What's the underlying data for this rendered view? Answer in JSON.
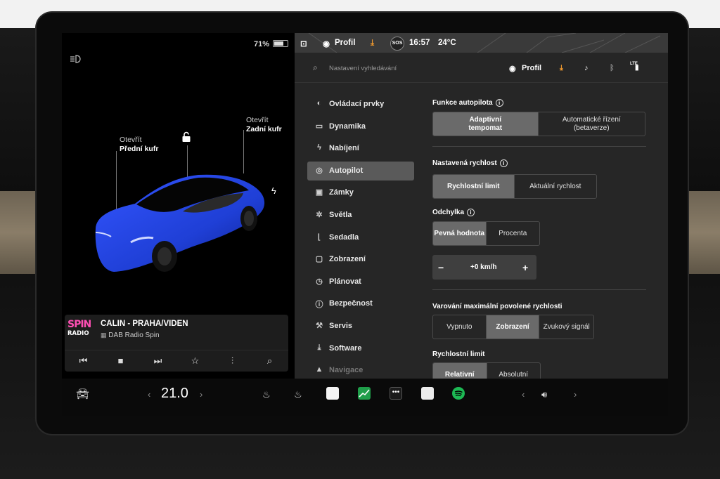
{
  "left": {
    "battery_pct": "71%",
    "battery_level": 0.71,
    "front_trunk": {
      "line1": "Otevřít",
      "line2": "Přední kufr"
    },
    "rear_trunk": {
      "line1": "Otevřít",
      "line2": "Zadní kufr"
    },
    "icons": {
      "headlight": "headlight-icon",
      "unlock": "unlock-icon",
      "charge": "bolt-icon"
    }
  },
  "media": {
    "logo_top": "SPIN",
    "logo_bottom": "RADIO",
    "title": "CALIN - PRAHA/VIDEN",
    "source": "DAB Radio Spin",
    "controls": [
      "previous-icon",
      "stop-icon",
      "next-icon",
      "star-icon",
      "equalizer-icon",
      "search-icon"
    ]
  },
  "status_bar": {
    "profile": "Profil",
    "sos": "SOS",
    "time": "16:57",
    "temp": "24°C"
  },
  "search": {
    "placeholder": "Nastavení vyhledávání",
    "profile": "Profil",
    "lte": "LTE"
  },
  "nav": [
    {
      "label": "Ovládací prvky",
      "icon": "toggle-icon",
      "glyph": "◐"
    },
    {
      "label": "Dynamika",
      "icon": "car-icon",
      "glyph": "▭"
    },
    {
      "label": "Nabíjení",
      "icon": "bolt-icon",
      "glyph": "ϟ"
    },
    {
      "label": "Autopilot",
      "icon": "steering-wheel-icon",
      "glyph": "◎",
      "active": true
    },
    {
      "label": "Zámky",
      "icon": "lock-icon",
      "glyph": "▣"
    },
    {
      "label": "Světla",
      "icon": "sun-icon",
      "glyph": "✲"
    },
    {
      "label": "Sedadla",
      "icon": "seat-icon",
      "glyph": "⌊"
    },
    {
      "label": "Zobrazení",
      "icon": "display-icon",
      "glyph": "▢"
    },
    {
      "label": "Plánovat",
      "icon": "alarm-clock-icon",
      "glyph": "◷"
    },
    {
      "label": "Bezpečnost",
      "icon": "shield-icon",
      "glyph": "ⓘ"
    },
    {
      "label": "Servis",
      "icon": "wrench-icon",
      "glyph": "⚒"
    },
    {
      "label": "Software",
      "icon": "download-icon",
      "glyph": "⤓"
    },
    {
      "label": "Navigace",
      "icon": "navigation-icon",
      "glyph": "▲"
    }
  ],
  "content": {
    "autopilot_features": {
      "title": "Funkce autopilota",
      "options": [
        "Adaptivní\ntempomat",
        "Automatické řízení\n(betaverze)"
      ],
      "selected": 0
    },
    "set_speed": {
      "title": "Nastavená rychlost",
      "options": [
        "Rychlostní limit",
        "Aktuální rychlost"
      ],
      "selected": 0
    },
    "offset": {
      "title": "Odchylka",
      "options": [
        "Pevná hodnota",
        "Procenta"
      ],
      "selected": 0,
      "minus": "−",
      "value": "+0 km/h",
      "plus": "+"
    },
    "speed_warning": {
      "title": "Varování maximální povolené rychlosti",
      "options": [
        "Vypnuto",
        "Zobrazení",
        "Zvukový signál"
      ],
      "selected": 1
    },
    "speed_limit": {
      "title": "Rychlostní limit",
      "options": [
        "Relativní",
        "Absolutní"
      ],
      "selected": 0
    }
  },
  "bottom_bar": {
    "climate_left_arrow": "‹",
    "temperature": "21.0",
    "climate_right_arrow": "›",
    "vol_left_arrow": "‹",
    "vol_right_arrow": "›",
    "apps": [
      "car-icon",
      "front-defrost-icon",
      "rear-defrost-icon",
      "notes-icon",
      "stocks-icon",
      "more-icon",
      "calendar-icon",
      "spotify-icon",
      "volume-icon"
    ]
  },
  "colors": {
    "accent_orange": "#f29a2e",
    "car_blue": "#1f3fd6",
    "spin_pink": "#ff4fb4",
    "spotify_green": "#1db954"
  }
}
